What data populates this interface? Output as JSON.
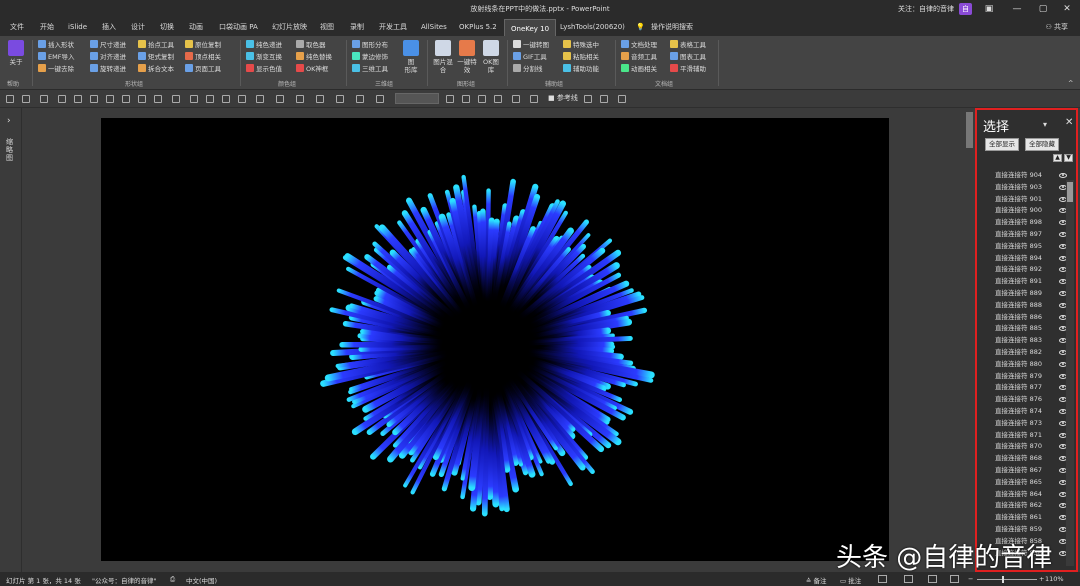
{
  "titlebar": {
    "doc_title": "放射线条在PPT中的做法.pptx  -  PowerPoint",
    "follow_text": "关注：自律的音律",
    "avatar_text": "自",
    "min": "—",
    "restore": "▢",
    "close": "✕"
  },
  "tabs": [
    "文件",
    "开始",
    "iSlide",
    "插入",
    "设计",
    "切换",
    "动画",
    "口袋动画 PA",
    "幻灯片放映",
    "视图",
    "录制",
    "开发工具",
    "AllSites",
    "OKPlus 5.2",
    "OneKey 10",
    "LyshTools(200620)",
    "操作说明搜索"
  ],
  "active_tab": "OneKey 10",
  "share": "共享",
  "ribbon": {
    "about_label": "关于",
    "about_group": "帮助",
    "shape_items": [
      "插入形状",
      "EMF导入",
      "一键去除",
      "尺寸递进",
      "对齐递进",
      "旋转递进",
      "拾点工具",
      "矩式复制",
      "拆合文本",
      "原位复制",
      "顶点相关",
      "页面工具"
    ],
    "shape_group": "形状组",
    "color_items": [
      "纯色递进",
      "渐变互换",
      "显示色值",
      "取色器",
      "纯色替换",
      "OK神框"
    ],
    "color_group": "颜色组",
    "threed_items": [
      "图形分布",
      "蒙边修饰",
      "三维工具"
    ],
    "threed_big": "图\n形库",
    "threed_group": "三维组",
    "image_big": [
      "图片混合",
      "一键特效",
      "OK图库"
    ],
    "image_group": "图形组",
    "assist_items": [
      "一键转图",
      "GIF工具",
      "分割线",
      "特殊选中",
      "粘贴相关",
      "辅助功能"
    ],
    "assist_group": "辅助组",
    "doc_items": [
      "文档处理",
      "音频工具",
      "动画相关",
      "表格工具",
      "图表工具",
      "平滑辅助"
    ],
    "doc_group": "文档组"
  },
  "qat": {
    "ref_line": "参考线"
  },
  "leftstrip": {
    "arrow": "›",
    "label": "缩略图"
  },
  "pane": {
    "title": "选择",
    "dropdown": "▾",
    "close": "✕",
    "show_all": "全部显示",
    "hide_all": "全部隐藏",
    "up": "▲",
    "down": "▼",
    "items": [
      "直接连接符 904",
      "直接连接符 903",
      "直接连接符 901",
      "直接连接符 900",
      "直接连接符 898",
      "直接连接符 897",
      "直接连接符 895",
      "直接连接符 894",
      "直接连接符 892",
      "直接连接符 891",
      "直接连接符 889",
      "直接连接符 888",
      "直接连接符 886",
      "直接连接符 885",
      "直接连接符 883",
      "直接连接符 882",
      "直接连接符 880",
      "直接连接符 879",
      "直接连接符 877",
      "直接连接符 876",
      "直接连接符 874",
      "直接连接符 873",
      "直接连接符 871",
      "直接连接符 870",
      "直接连接符 868",
      "直接连接符 867",
      "直接连接符 865",
      "直接连接符 864",
      "直接连接符 862",
      "直接连接符 861",
      "直接连接符 859",
      "直接连接符 858",
      "直接连接符 856"
    ]
  },
  "status": {
    "slide_info": "幻灯片 第 1 张，共 14 张",
    "account": "\"公众号：自律的音律\"",
    "language": "中文(中国)",
    "notes": "备注",
    "comments": "批注",
    "zoom": "110%"
  },
  "watermark": "头条 @自律的音律",
  "colors": {
    "accent_red": "#e02020",
    "active_tab_bg": "#444444",
    "ray_blue": "#1a2cff",
    "ray_tip": "#27d3ff"
  },
  "slide_graphic": {
    "type": "radial-burst",
    "ray_count": 180
  }
}
